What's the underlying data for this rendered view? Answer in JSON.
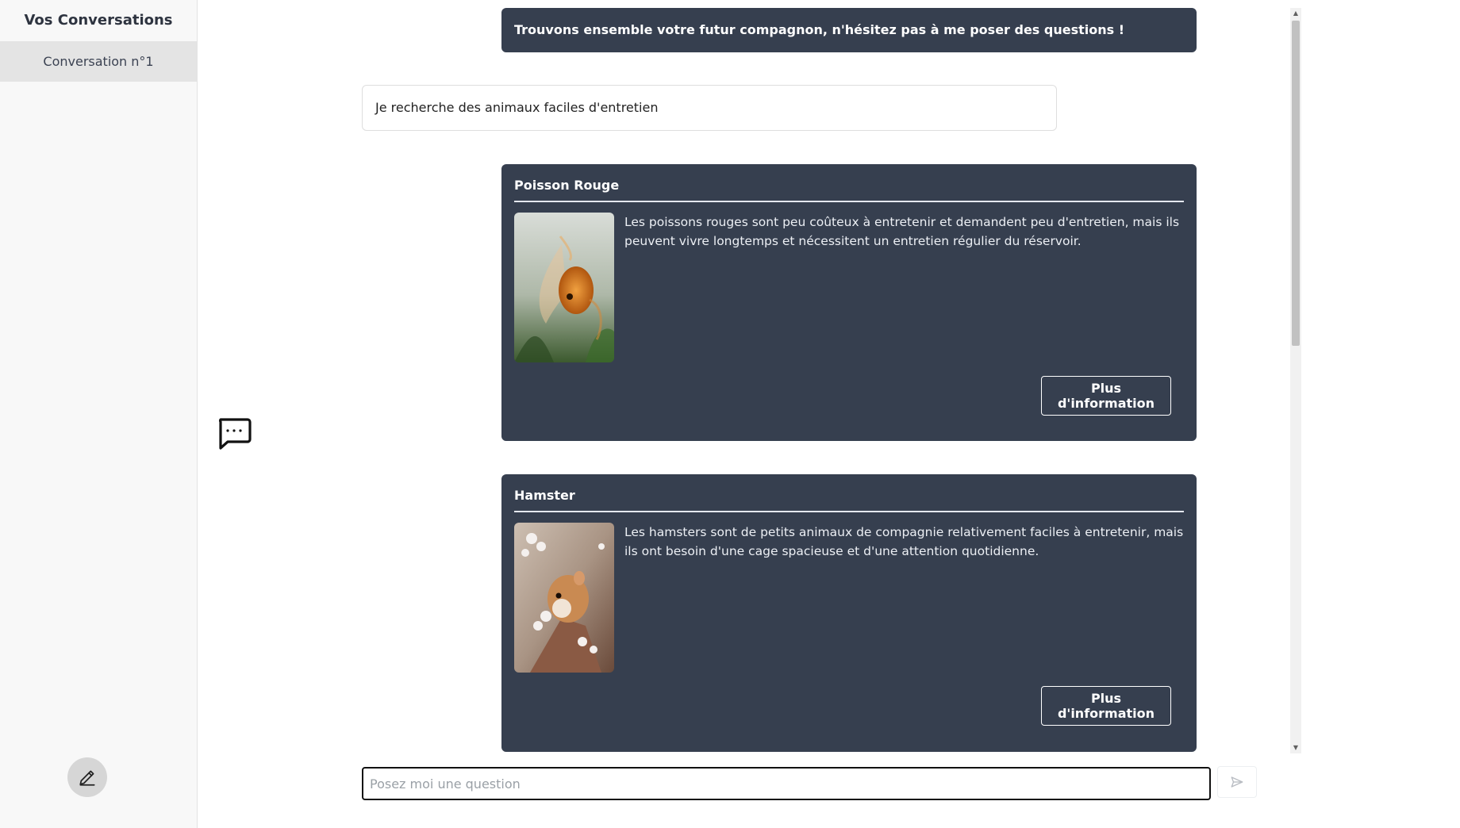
{
  "sidebar": {
    "title": "Vos Conversations",
    "conversations": [
      {
        "label": "Conversation n°1"
      }
    ],
    "new_conversation_icon": "pencil-icon"
  },
  "chat": {
    "greeting": "Trouvons ensemble votre futur compagnon, n'hésitez pas à me poser des questions !",
    "user_message": "Je recherche des animaux faciles d'entretien",
    "cards": [
      {
        "title": "Poisson Rouge",
        "description": "Les poissons rouges sont peu coûteux à entretenir et demandent peu d'entretien, mais ils peuvent vivre longtemps et nécessitent un entretien régulier du réservoir.",
        "button": "Plus d'information",
        "image": "goldfish-photo"
      },
      {
        "title": "Hamster",
        "description": "Les hamsters sont de petits animaux de compagnie relativement faciles à entretenir, mais ils ont besoin d'une cage spacieuse et d'une attention quotidienne.",
        "button": "Plus d'information",
        "image": "hamster-photo"
      }
    ]
  },
  "input": {
    "placeholder": "Posez moi une question",
    "value": ""
  },
  "colors": {
    "card_bg": "#363f4f",
    "sidebar_bg": "#f8f8f8",
    "accent": "#ffffff"
  }
}
